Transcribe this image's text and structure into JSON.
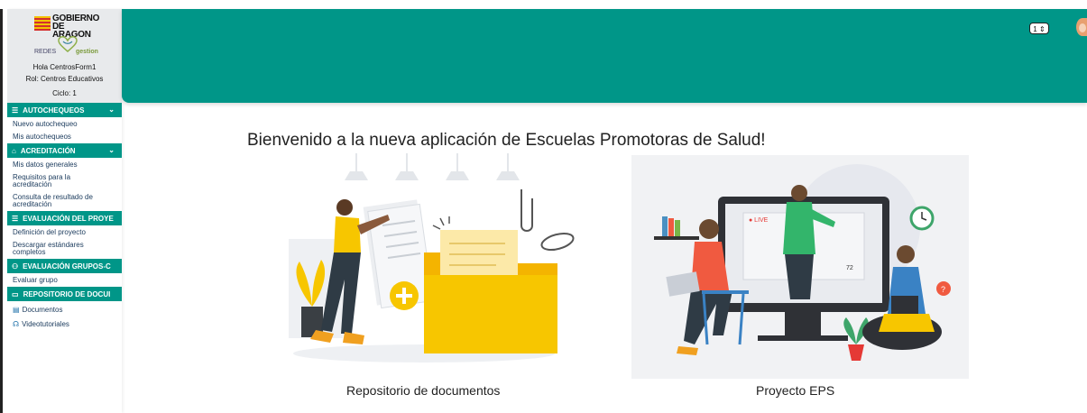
{
  "sidebar": {
    "logo_text": "GOBIERNO DE ARAGON",
    "logo_line1": "GOBIERNO",
    "logo_line2": "DE ARAGON",
    "network_left": "REDES",
    "network_right": "gestion",
    "greeting": "Hola CentrosForm1",
    "role": "Rol: Centros Educativos",
    "cycle": "Ciclo: 1",
    "sections": [
      {
        "label": "AUTOCHEQUEOS",
        "icon": "list-icon",
        "items": [
          "Nuevo autochequeo",
          "Mis autochequeos"
        ]
      },
      {
        "label": "ACREDITACIÓN",
        "icon": "badge-icon",
        "items": [
          "Mis datos generales",
          "Requisitos para la acreditación",
          "Consulta de resultado de acreditación"
        ]
      },
      {
        "label": "EVALUACIÓN DEL PROYE",
        "icon": "list-icon",
        "items": [
          "Definición del proyecto",
          "Descargar estándares completos"
        ]
      },
      {
        "label": "EVALUACIÓN GRUPOS-C",
        "icon": "group-icon",
        "items": [
          "Evaluar grupo"
        ]
      },
      {
        "label": "REPOSITORIO DE DOCUI",
        "icon": "folder-icon",
        "items": [
          "Documentos",
          "Videotutoriales"
        ]
      }
    ]
  },
  "header": {
    "selector_value": "1"
  },
  "main": {
    "welcome": "Bienvenido a la nueva aplicación de Escuelas Promotoras de Salud!",
    "cards": [
      {
        "label": "Repositorio de documentos",
        "illustration": "document-folder-illustration"
      },
      {
        "label": "Proyecto EPS",
        "illustration": "online-meeting-illustration"
      }
    ]
  },
  "colors": {
    "accent": "#009688",
    "header_bg": "#e8eaec",
    "link": "#1a3a5c",
    "illustration_yellow": "#f7c600",
    "illustration_red": "#f05a40"
  }
}
